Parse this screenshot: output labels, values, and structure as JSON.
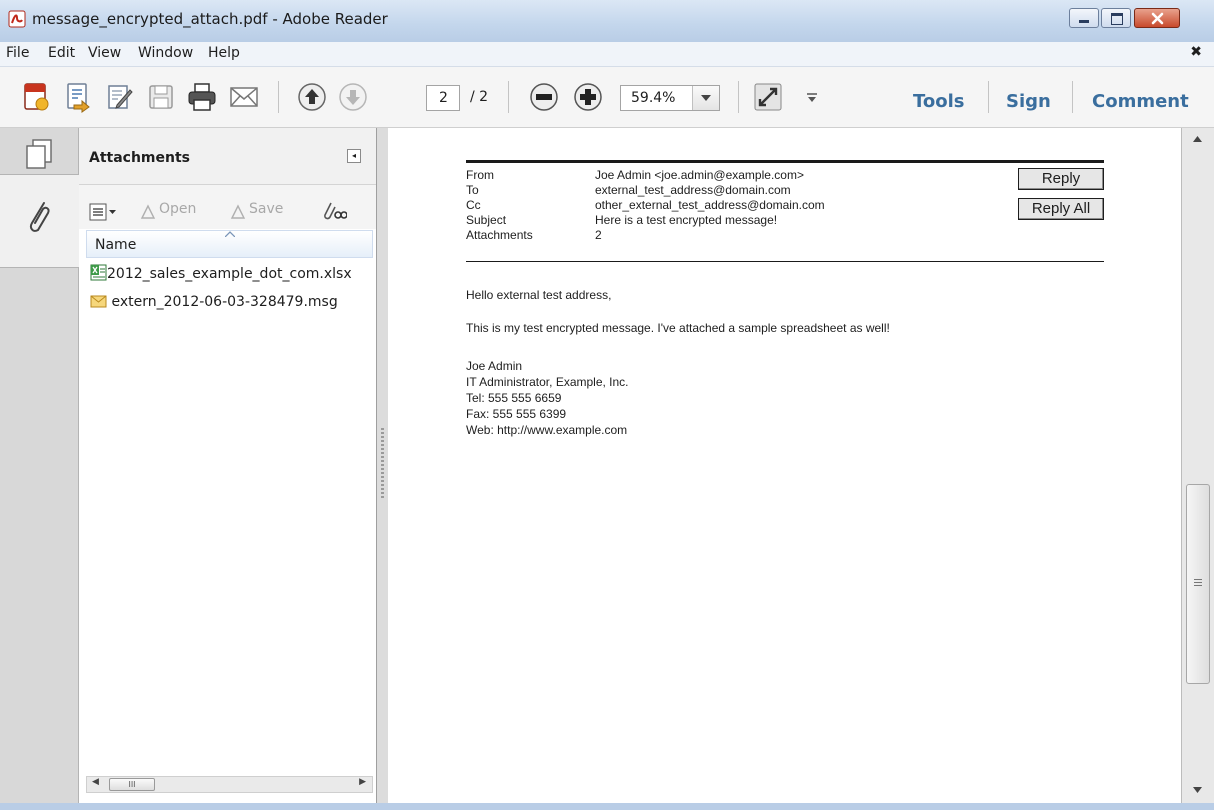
{
  "window": {
    "title": "message_encrypted_attach.pdf - Adobe Reader"
  },
  "menu": {
    "items": [
      "File",
      "Edit",
      "View",
      "Window",
      "Help"
    ],
    "close_glyph": "✖"
  },
  "toolbar": {
    "page_current": "2",
    "page_total": "/ 2",
    "zoom": "59.4%",
    "links": {
      "tools": "Tools",
      "sign": "Sign",
      "comment": "Comment"
    },
    "icons": [
      "create-pdf-icon",
      "export-icon",
      "edit-icon",
      "save-icon",
      "print-icon",
      "email-icon",
      "page-up-icon",
      "page-down-icon",
      "zoom-out-icon",
      "zoom-in-icon",
      "fit-page-icon",
      "toolbar-menu-icon"
    ]
  },
  "attachments_panel": {
    "title": "Attachments",
    "tools": {
      "open": "Open",
      "save": "Save"
    },
    "column_name": "Name",
    "files": [
      {
        "name": "2012_sales_example_dot_com.xlsx",
        "icon": "excel-file-icon"
      },
      {
        "name": "extern_2012-06-03-328479.msg",
        "icon": "email-file-icon"
      }
    ],
    "scroll_glyph": "III"
  },
  "message": {
    "headers": [
      {
        "label": "From",
        "value": "Joe Admin <joe.admin@example.com>"
      },
      {
        "label": "To",
        "value": "external_test_address@domain.com"
      },
      {
        "label": "Cc",
        "value": "other_external_test_address@domain.com"
      },
      {
        "label": "Subject",
        "value": "Here is a test encrypted message!"
      },
      {
        "label": "Attachments",
        "value": "2"
      }
    ],
    "buttons": {
      "reply": "Reply",
      "reply_all": "Reply All"
    },
    "body": {
      "greeting": "Hello external test address,",
      "text": "This is my test encrypted message. I've attached a sample spreadsheet as well!",
      "signature": [
        "Joe Admin",
        "IT Administrator, Example, Inc.",
        "Tel: 555 555 6659",
        "Fax: 555 555 6399",
        "Web: http://www.example.com"
      ]
    }
  },
  "colors": {
    "accent": "#3a6e9e",
    "titlebar": "#c3d6ec",
    "close_button": "#c84a2c"
  }
}
